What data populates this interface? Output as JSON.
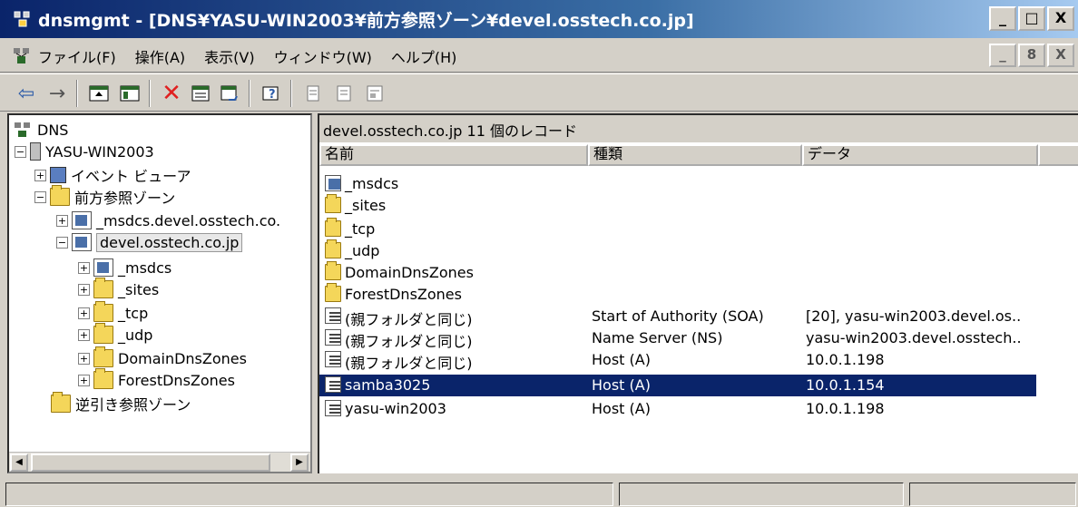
{
  "window": {
    "title": "dnsmgmt - [DNS¥YASU-WIN2003¥前方参照ゾーン¥devel.osstech.co.jp]",
    "min_label": "_",
    "max_label": "□",
    "close_label": "X"
  },
  "menu": {
    "items": [
      "ファイル(F)",
      "操作(A)",
      "表示(V)",
      "ウィンドウ(W)",
      "ヘルプ(H)"
    ],
    "mdi_min": "_",
    "mdi_restore": "8",
    "mdi_close": "X"
  },
  "toolbar": {
    "icons": [
      "back-arrow-icon",
      "forward-arrow-icon",
      "up-folder-icon",
      "show-hide-tree-icon",
      "delete-icon",
      "properties-icon",
      "refresh-icon",
      "help-icon",
      "record-icon-1",
      "record-icon-2",
      "record-icon-3"
    ],
    "delete_color": "#e02020"
  },
  "tree": {
    "root": "DNS",
    "server": "YASU-WIN2003",
    "items": [
      {
        "label": "イベント ビューア"
      },
      {
        "label": "前方参照ゾーン"
      },
      {
        "label": "_msdcs.devel.osstech.co."
      },
      {
        "label": "devel.osstech.co.jp"
      },
      {
        "label": "_msdcs"
      },
      {
        "label": "_sites"
      },
      {
        "label": "_tcp"
      },
      {
        "label": "_udp"
      },
      {
        "label": "DomainDnsZones"
      },
      {
        "label": "ForestDnsZones"
      },
      {
        "label": "逆引き参照ゾーン"
      }
    ]
  },
  "list": {
    "header": "devel.osstech.co.jp    11 個のレコード",
    "columns": [
      "名前",
      "種類",
      "データ"
    ],
    "rows": [
      {
        "name": "_msdcs",
        "type": "",
        "data": "",
        "icon": "zone-folder-icon"
      },
      {
        "name": "_sites",
        "type": "",
        "data": "",
        "icon": "folder-icon"
      },
      {
        "name": "_tcp",
        "type": "",
        "data": "",
        "icon": "folder-icon"
      },
      {
        "name": "_udp",
        "type": "",
        "data": "",
        "icon": "folder-icon"
      },
      {
        "name": "DomainDnsZones",
        "type": "",
        "data": "",
        "icon": "folder-icon"
      },
      {
        "name": "ForestDnsZones",
        "type": "",
        "data": "",
        "icon": "folder-icon"
      },
      {
        "name": "(親フォルダと同じ)",
        "type": "Start of Authority (SOA)",
        "data": "[20], yasu-win2003.devel.os..",
        "icon": "record-icon"
      },
      {
        "name": "(親フォルダと同じ)",
        "type": "Name Server (NS)",
        "data": "yasu-win2003.devel.osstech..",
        "icon": "record-icon"
      },
      {
        "name": "(親フォルダと同じ)",
        "type": "Host (A)",
        "data": "10.0.1.198",
        "icon": "record-icon"
      },
      {
        "name": "samba3025",
        "type": "Host (A)",
        "data": "10.0.1.154",
        "icon": "record-icon",
        "selected": true
      },
      {
        "name": "yasu-win2003",
        "type": "Host (A)",
        "data": "10.0.1.198",
        "icon": "record-icon"
      }
    ]
  },
  "colors": {
    "title_gradient_start": "#0a246a",
    "title_gradient_end": "#a6caf0",
    "selection": "#0a246a",
    "chrome": "#d4d0c8"
  }
}
